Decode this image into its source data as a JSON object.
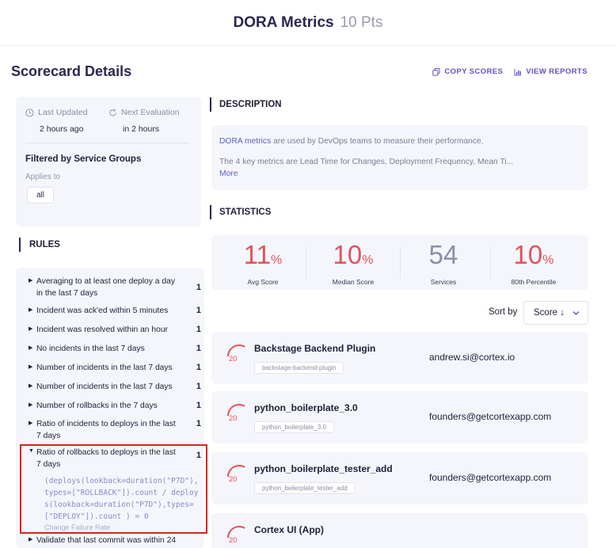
{
  "header": {
    "title": "DORA Metrics",
    "points": "10 Pts"
  },
  "scorecard": {
    "title": "Scorecard Details",
    "actions": {
      "copy": "COPY SCORES",
      "view": "VIEW REPORTS"
    }
  },
  "info": {
    "last_updated_label": "Last Updated",
    "last_updated_value": "2 hours ago",
    "next_eval_label": "Next Evaluation",
    "next_eval_value": "in 2 hours",
    "filter_title": "Filtered by Service Groups",
    "applies_label": "Applies to",
    "applies_value": "all"
  },
  "rules": {
    "header": "RULES",
    "items": [
      {
        "text": "Averaging to at least one deploy a day in the last 7 days",
        "count": "1"
      },
      {
        "text": "Incident was ack'ed within 5 minutes",
        "count": "1"
      },
      {
        "text": "Incident was resolved within an hour",
        "count": "1"
      },
      {
        "text": "No incidents in the last 7 days",
        "count": "1"
      },
      {
        "text": "Number of incidents in the last 7 days",
        "count": "1"
      },
      {
        "text": "Number of incidents in the last 7 days",
        "count": "1"
      },
      {
        "text": "Number of rollbacks in the 7 days",
        "count": "1"
      },
      {
        "text": "Ratio of incidents to deploys in the last 7 days",
        "count": "1"
      },
      {
        "text": "Ratio of rollbacks to deploys in the last 7 days",
        "count": "1"
      },
      {
        "text": "Validate that last commit was within 24",
        "count": ""
      }
    ],
    "expanded_expression": "(deploys(lookback=duration(\"P7D\"),types=[\"ROLLBACK\"]).count / deploys(lookback=duration(\"P7D\"),types=[\"DEPLOY\"]).count ) = 0",
    "expanded_subtitle": "Change Failure Rate"
  },
  "description": {
    "header": "DESCRIPTION",
    "link_text": "DORA metrics",
    "line1_rest": " are used by DevOps teams to measure their performance.",
    "line2": "The 4 key metrics are Lead Time for Changes, Deployment Frequency, Mean Ti...",
    "more": "More"
  },
  "statistics": {
    "header": "STATISTICS",
    "items": [
      {
        "value": "11",
        "unit": "%",
        "label": "Avg Score",
        "color": "#e4525d"
      },
      {
        "value": "10",
        "unit": "%",
        "label": "Median Score",
        "color": "#e4525d"
      },
      {
        "value": "54",
        "unit": "",
        "label": "Services",
        "color": "#8b8fa6"
      },
      {
        "value": "10",
        "unit": "%",
        "label": "80th Percentile",
        "color": "#e4525d"
      }
    ]
  },
  "sort": {
    "label": "Sort by",
    "value": "Score ↓"
  },
  "services": [
    {
      "score": "20",
      "name": "Backstage Backend Plugin",
      "tag": "backstage-backend-plugin",
      "owner": "andrew.si@cortex.io"
    },
    {
      "score": "20",
      "name": "python_boilerplate_3.0",
      "tag": "python_boilerplate_3.0",
      "owner": "founders@getcortexapp.com"
    },
    {
      "score": "20",
      "name": "python_boilerplate_tester_add",
      "tag": "python_boilerplate_tester_add",
      "owner": "founders@getcortexapp.com"
    },
    {
      "score": "20",
      "name": "Cortex UI (App)",
      "tag": "",
      "owner": ""
    }
  ],
  "colors": {
    "accent": "#6052c8",
    "score_red": "#e4525d",
    "highlight": "#e02020"
  }
}
